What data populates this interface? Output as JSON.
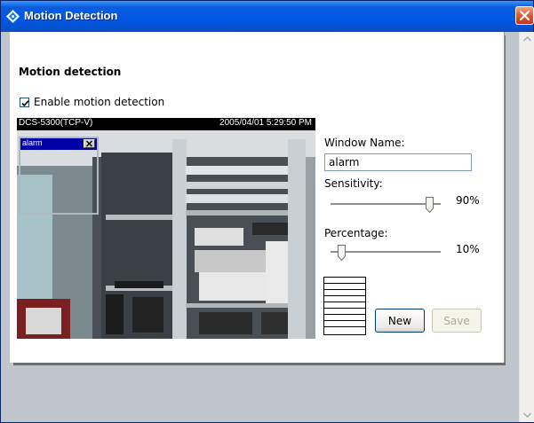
{
  "window": {
    "title": "Motion Detection"
  },
  "section": {
    "heading": "Motion detection"
  },
  "enable": {
    "label": "Enable motion detection",
    "checked": true
  },
  "video": {
    "camera_name": "DCS-5300(TCP-V)",
    "timestamp": "2005/04/01 5:29:50 PM"
  },
  "motion_window": {
    "title": "alarm"
  },
  "form": {
    "window_name_label": "Window Name:",
    "window_name_value": "alarm",
    "sensitivity_label": "Sensitivity:",
    "sensitivity_value": 0.9,
    "sensitivity_text": "90%",
    "percentage_label": "Percentage:",
    "percentage_value": 0.1,
    "percentage_text": "10%"
  },
  "buttons": {
    "new_label": "New",
    "save_label": "Save"
  },
  "icons": {
    "title": "motion-detection-app-icon",
    "close": "close-icon",
    "scroll_up": "scroll-up-arrow-icon",
    "scroll_down": "scroll-down-arrow-icon",
    "checkbox": "checkmark-icon"
  },
  "colors": {
    "titlebar": "#0058e6",
    "close": "#e2572a",
    "motion_window_titlebar": "#0000a8"
  }
}
